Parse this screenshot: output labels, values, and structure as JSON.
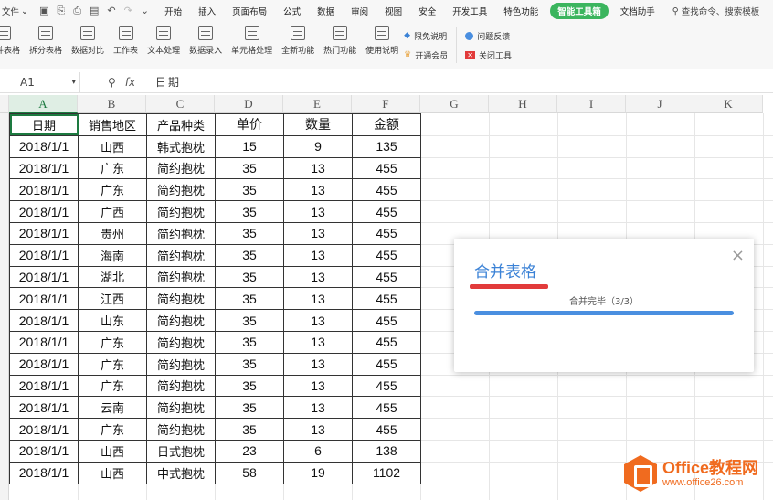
{
  "menubar": {
    "file_label": "文件",
    "tabs": [
      "开始",
      "插入",
      "页面布局",
      "公式",
      "数据",
      "审阅",
      "视图",
      "安全",
      "开发工具",
      "特色功能"
    ],
    "active_tab": "智能工具箱",
    "extra_tab": "文档助手",
    "search_label": "查找命令、搜索模板"
  },
  "ribbon": {
    "buttons": [
      "合并表格",
      "拆分表格",
      "数据对比",
      "工作表",
      "文本处理",
      "数据录入",
      "单元格处理",
      "全新功能",
      "热门功能",
      "使用说明"
    ],
    "small1": [
      "限免说明",
      "开通会员"
    ],
    "small2": [
      "问题反馈",
      "关闭工具"
    ]
  },
  "formula_bar": {
    "cell_ref": "A1",
    "fx_label": "fx",
    "value": "日期"
  },
  "columns": [
    "A",
    "B",
    "C",
    "D",
    "E",
    "F",
    "G",
    "H",
    "I",
    "J",
    "K"
  ],
  "table": {
    "headers": [
      "日期",
      "销售地区",
      "产品种类",
      "单价",
      "数量",
      "金额"
    ],
    "rows": [
      [
        "2018/1/1",
        "山西",
        "韩式抱枕",
        "15",
        "9",
        "135"
      ],
      [
        "2018/1/1",
        "广东",
        "简约抱枕",
        "35",
        "13",
        "455"
      ],
      [
        "2018/1/1",
        "广东",
        "简约抱枕",
        "35",
        "13",
        "455"
      ],
      [
        "2018/1/1",
        "广西",
        "简约抱枕",
        "35",
        "13",
        "455"
      ],
      [
        "2018/1/1",
        "贵州",
        "简约抱枕",
        "35",
        "13",
        "455"
      ],
      [
        "2018/1/1",
        "海南",
        "简约抱枕",
        "35",
        "13",
        "455"
      ],
      [
        "2018/1/1",
        "湖北",
        "简约抱枕",
        "35",
        "13",
        "455"
      ],
      [
        "2018/1/1",
        "江西",
        "简约抱枕",
        "35",
        "13",
        "455"
      ],
      [
        "2018/1/1",
        "山东",
        "简约抱枕",
        "35",
        "13",
        "455"
      ],
      [
        "2018/1/1",
        "广东",
        "简约抱枕",
        "35",
        "13",
        "455"
      ],
      [
        "2018/1/1",
        "广东",
        "简约抱枕",
        "35",
        "13",
        "455"
      ],
      [
        "2018/1/1",
        "广东",
        "简约抱枕",
        "35",
        "13",
        "455"
      ],
      [
        "2018/1/1",
        "云南",
        "简约抱枕",
        "35",
        "13",
        "455"
      ],
      [
        "2018/1/1",
        "广东",
        "简约抱枕",
        "35",
        "13",
        "455"
      ],
      [
        "2018/1/1",
        "山西",
        "日式抱枕",
        "23",
        "6",
        "138"
      ],
      [
        "2018/1/1",
        "山西",
        "中式抱枕",
        "58",
        "19",
        "1102"
      ]
    ]
  },
  "dialog": {
    "title": "合并表格",
    "status": "合并完毕（3/3）",
    "progress": 1.0,
    "close": "×"
  },
  "watermark": {
    "brand": "Office教程网",
    "url": "www.office26.com"
  },
  "colors": {
    "accent_green": "#3bb55e",
    "dialog_title": "#3b82d6",
    "underline_red": "#e23b3b",
    "progress_blue": "#4a8fe0",
    "watermark_orange": "#f06b1f"
  }
}
